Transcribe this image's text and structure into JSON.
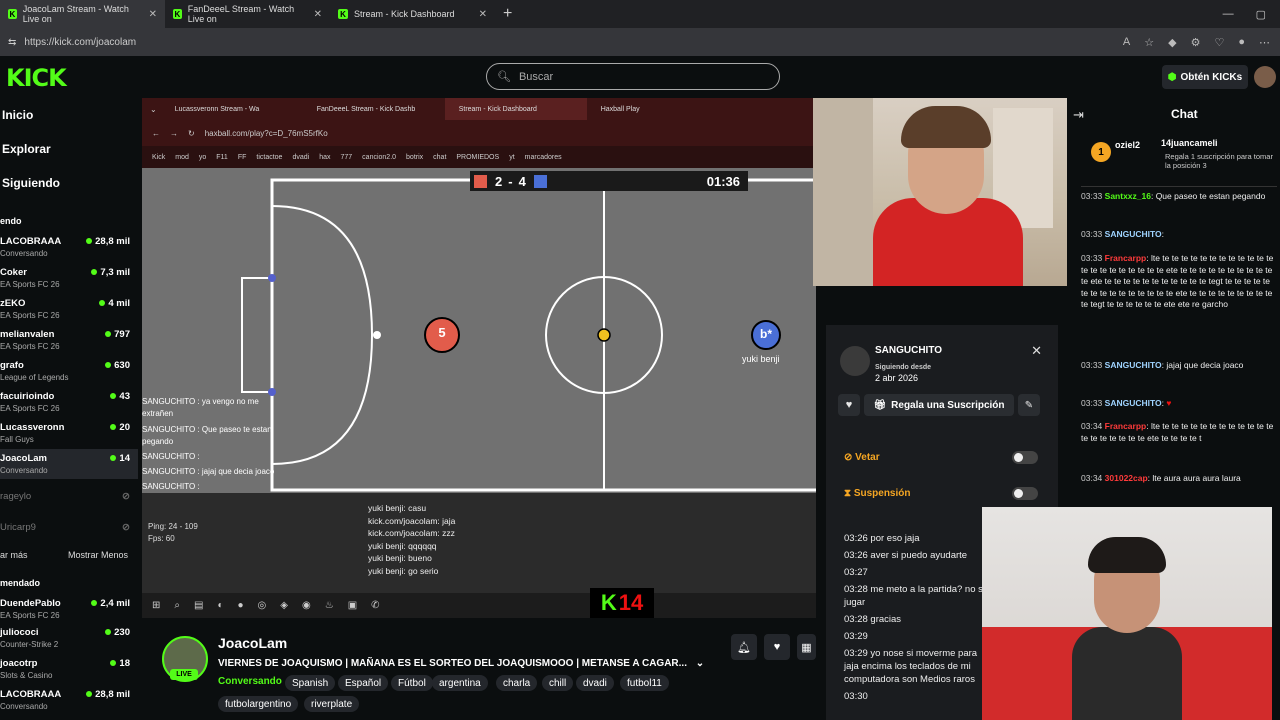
{
  "browser": {
    "tabs": [
      {
        "label": "JoacoLam Stream - Watch Live on"
      },
      {
        "label": "FanDeeeL Stream - Watch Live on"
      },
      {
        "label": "Stream - Kick Dashboard"
      }
    ],
    "url": "https://kick.com/joacolam"
  },
  "header": {
    "logo": "KICK",
    "search_placeholder": "Buscar",
    "get_kicks": "Obtén KICKs"
  },
  "sidebar": {
    "nav": [
      {
        "label": "Inicio"
      },
      {
        "label": "Explorar"
      },
      {
        "label": "Siguiendo"
      }
    ],
    "following_title": "endo",
    "following": [
      {
        "name": "LACOBRAAA",
        "game": "Conversando",
        "viewers": "28,8 mil"
      },
      {
        "name": "Coker",
        "game": "EA Sports FC 26",
        "viewers": "7,3 mil"
      },
      {
        "name": "zEKO",
        "game": "EA Sports FC 26",
        "viewers": "4 mil"
      },
      {
        "name": "melianvalen",
        "game": "EA Sports FC 26",
        "viewers": "797"
      },
      {
        "name": "grafo",
        "game": "League of Legends",
        "viewers": "630"
      },
      {
        "name": "facuirioindo",
        "game": "EA Sports FC 26",
        "viewers": "43"
      },
      {
        "name": "Lucassveronn",
        "game": "Fall Guys",
        "viewers": "20"
      },
      {
        "name": "JoacoLam",
        "game": "Conversando",
        "viewers": "14"
      }
    ],
    "offline": [
      {
        "name": "rageylo"
      },
      {
        "name": "Uricarp9"
      }
    ],
    "show_more": "ar más",
    "show_less": "Mostrar Menos",
    "recommended_title": "mendado",
    "recommended": [
      {
        "name": "DuendePablo",
        "game": "EA Sports FC 26",
        "viewers": "2,4 mil"
      },
      {
        "name": "juliococi",
        "game": "Counter-Strike 2",
        "viewers": "230"
      },
      {
        "name": "joacotrp",
        "game": "Slots & Casino",
        "viewers": "18"
      },
      {
        "name": "LACOBRAAA",
        "game": "Conversando",
        "viewers": "28,8 mil"
      }
    ]
  },
  "stream": {
    "inner_tabs": [
      {
        "label": "Lucassveronn Stream - Wa"
      },
      {
        "label": "FanDeeeL Stream - Kick Dashb"
      },
      {
        "label": "Stream - Kick Dashboard"
      },
      {
        "label": "Haxball Play"
      }
    ],
    "inner_url": "haxball.com/play?c=D_76mS5rfKo",
    "bookmarks": [
      "Kick",
      "mod",
      "yo",
      "F11",
      "FF",
      "tictactoe",
      "dvadi",
      "hax",
      "777",
      "cancion2.0",
      "botrix",
      "chat",
      "PROMIEDOS",
      "yt",
      "marcadores"
    ],
    "score": {
      "red": "2",
      "sep": "-",
      "blue": "4",
      "time": "01:36"
    },
    "player_red": "5",
    "player_blue": "b*",
    "player_blue_name": "yuki benji",
    "overlay_chat": [
      "SANGUCHITO : ya vengo no me extrañen",
      "SANGUCHITO : Que paseo te estan pegando",
      "SANGUCHITO :",
      "SANGUCHITO : jajaj que decia joaco",
      "SANGUCHITO :"
    ],
    "ping": "Ping: 24 - 109",
    "fps": "Fps: 60",
    "game_chat": [
      "yuki benji: casu",
      "kick.com/joacolam: jaja",
      "kick.com/joacolam: zzz",
      "yuki benji: qqqqqq",
      "yuki benji: bueno",
      "yuki benji: go serio"
    ],
    "klogo_a": "K",
    "klogo_b": "14"
  },
  "usercard": {
    "username": "SANGUCHITO",
    "following_since_label": "Siguiendo desde",
    "following_since": "2 abr 2026",
    "gift_label": "Regala una Suscripción",
    "veto_label": "Vetar",
    "suspension_label": "Suspensión",
    "history": [
      "03:26 por eso jaja",
      "03:26 aver si puedo ayudarte",
      "03:27",
      "03:28 me meto a la partida? no se jugar",
      "03:28 gracias",
      "03:29",
      "03:29 yo nose si moverme para jaja encima los teclados de mi computadora son Medios raros",
      "03:30"
    ]
  },
  "chat": {
    "title": "Chat",
    "pinned": {
      "user1": "oziel2",
      "user2": "14juancameli",
      "text": "Regala 1 suscripción para tomar la posición 3"
    },
    "messages": [
      {
        "time": "03:33",
        "user": "Santxxz_16",
        "text": ": Que paseo te estan pegando",
        "color": "#53fc18"
      },
      {
        "time": "03:33",
        "user": "SANGUCHITO",
        "text": ":",
        "color": "#9fd3ff"
      },
      {
        "time": "03:33",
        "user": "Francarpp",
        "text": ": lte te te te te te te te te te te te te te te te te te te te te te ete te te te te te te te te te te te ete te te te te te te te te te te te tegt te te te te te te te te te te te te te te te ete te te te te te te te te te te tegt te te te te te te ete ete re garcho",
        "color": "#ff3b3b"
      },
      {
        "time": "03:33",
        "user": "SANGUCHITO",
        "text": ": jajaj que decia joaco",
        "color": "#9fd3ff"
      },
      {
        "time": "03:33",
        "user": "SANGUCHITO",
        "text": ":",
        "color": "#9fd3ff"
      },
      {
        "time": "03:34",
        "user": "Francarpp",
        "text": ": lte te te te te te te te te te te te te te te te te te te te ete te te te te t",
        "color": "#ff3b3b"
      },
      {
        "time": "03:34",
        "user": "301022cap",
        "text": ": lte aura aura aura laura",
        "color": "#ff3b3b"
      }
    ]
  },
  "info": {
    "channel": "JoacoLam",
    "live": "LIVE",
    "title": "VIERNES DE JOAQUISMO | MAÑANA ES EL SORTEO DEL JOAQUISMOOO | METANSE A CAGAR...",
    "category": "Conversando",
    "tags": [
      "Spanish",
      "Español",
      "Fútbol",
      "argentina",
      "charla",
      "chill",
      "dvadi",
      "futbol11",
      "futbolargentino",
      "riverplate"
    ]
  },
  "colors": {
    "brand": "#53fc18",
    "bg": "#0b0e0f",
    "panel": "#24272c"
  }
}
